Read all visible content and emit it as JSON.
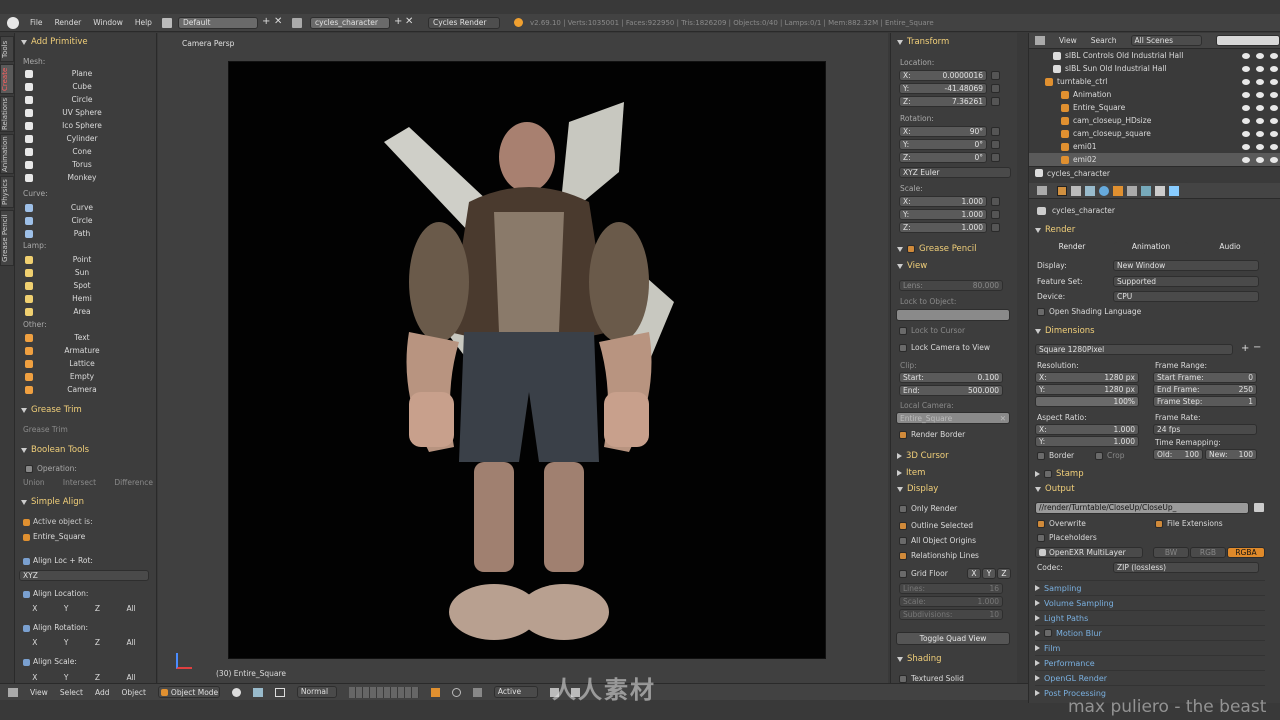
{
  "menubar": {
    "items": [
      "File",
      "Render",
      "Window",
      "Help"
    ],
    "layout": "Default",
    "scene": "cycles_character",
    "engine": "Cycles Render",
    "stats": "v2.69.10 | Verts:1035001 | Faces:922950 | Tris:1826209 | Objects:0/40 | Lamps:0/1 | Mem:882.32M | Entire_Square"
  },
  "tooltabs": [
    "Tools",
    "Create",
    "Relations",
    "Animation",
    "Physics",
    "Grease Pencil"
  ],
  "add_primitive": {
    "title": "Add Primitive",
    "mesh_label": "Mesh:",
    "mesh": [
      "Plane",
      "Cube",
      "Circle",
      "UV Sphere",
      "Ico Sphere",
      "Cylinder",
      "Cone",
      "Torus",
      "Monkey"
    ],
    "curve_label": "Curve:",
    "curve": [
      "Curve",
      "Circle",
      "Path"
    ],
    "lamp_label": "Lamp:",
    "lamp": [
      "Point",
      "Sun",
      "Spot",
      "Hemi",
      "Area"
    ],
    "other_label": "Other:",
    "other": [
      "Text",
      "Armature",
      "Lattice",
      "Empty",
      "Camera"
    ]
  },
  "grease_trim": {
    "title": "Grease Trim",
    "button": "Grease Trim"
  },
  "boolean_tools": {
    "title": "Boolean Tools",
    "operation": "Operation:",
    "ops": [
      "Union",
      "Intersect",
      "Difference"
    ]
  },
  "simple_align": {
    "title": "Simple Align",
    "active_label": "Active object is:",
    "active": "Entire_Square",
    "loc_rot": "Align Loc + Rot:",
    "xyz": "XYZ",
    "location": "Align Location:",
    "rotation": "Align Rotation:",
    "scale": "Align Scale:",
    "axes": [
      "X",
      "Y",
      "Z",
      "All"
    ]
  },
  "viewport": {
    "label": "Camera Persp",
    "object": "(30) Entire_Square"
  },
  "transform": {
    "title": "Transform",
    "location_label": "Location:",
    "loc": [
      {
        "a": "X:",
        "v": "0.0000016"
      },
      {
        "a": "Y:",
        "v": "-41.48069"
      },
      {
        "a": "Z:",
        "v": "7.36261"
      }
    ],
    "rotation_label": "Rotation:",
    "rot": [
      {
        "a": "X:",
        "v": "90°"
      },
      {
        "a": "Y:",
        "v": "0°"
      },
      {
        "a": "Z:",
        "v": "0°"
      }
    ],
    "euler": "XYZ Euler",
    "scale_label": "Scale:",
    "scl": [
      {
        "a": "X:",
        "v": "1.000"
      },
      {
        "a": "Y:",
        "v": "1.000"
      },
      {
        "a": "Z:",
        "v": "1.000"
      }
    ]
  },
  "npanel": {
    "grease_pencil": "Grease Pencil",
    "view": "View",
    "lens_label": "Lens:",
    "lens": "80.000",
    "lock_obj": "Lock to Object:",
    "lock_cursor": "Lock to Cursor",
    "lock_camera": "Lock Camera to View",
    "clip": "Clip:",
    "clip_start_l": "Start:",
    "clip_start": "0.100",
    "clip_end_l": "End:",
    "clip_end": "500.000",
    "local_camera": "Local Camera:",
    "local_camera_val": "Entire_Square",
    "render_border": "Render Border",
    "cursor3d": "3D Cursor",
    "item": "Item",
    "display": "Display",
    "only_render": "Only Render",
    "outline_sel": "Outline Selected",
    "all_origins": "All Object Origins",
    "rel_lines": "Relationship Lines",
    "grid_floor": "Grid Floor",
    "gaxes": [
      "X",
      "Y",
      "Z"
    ],
    "lines_l": "Lines:",
    "lines": "16",
    "scale_l": "Scale:",
    "scale": "1.000",
    "subdiv_l": "Subdivisions:",
    "subdiv": "10",
    "toggle_quad": "Toggle Quad View",
    "shading": "Shading",
    "textured_solid": "Textured Solid"
  },
  "outliner": {
    "menu": [
      "View",
      "Search",
      "All Scenes"
    ],
    "rows": [
      "sIBL Controls Old Industrial Hall",
      "sIBL Sun Old Industrial Hall",
      "turntable_ctrl",
      "Animation",
      "Entire_Square",
      "cam_closeup_HDsize",
      "cam_closeup_square",
      "emi01",
      "emi02",
      "cycles_character"
    ]
  },
  "props": {
    "scene": "cycles_character",
    "render_title": "Render",
    "render_btns": [
      "Render",
      "Animation",
      "Audio"
    ],
    "display_l": "Display:",
    "display": "New Window",
    "featureset_l": "Feature Set:",
    "featureset": "Supported",
    "device_l": "Device:",
    "device": "CPU",
    "osl": "Open Shading Language",
    "dimensions": "Dimensions",
    "preset": "Square 1280Pixel",
    "resolution": "Resolution:",
    "resx_l": "X:",
    "resx": "1280 px",
    "resy_l": "Y:",
    "resy": "1280 px",
    "respct": "100%",
    "frame_range": "Frame Range:",
    "start_l": "Start Frame:",
    "start": "0",
    "end_l": "End Frame:",
    "end": "250",
    "step_l": "Frame Step:",
    "step": "1",
    "aspect": "Aspect Ratio:",
    "ax_l": "X:",
    "ax": "1.000",
    "ay_l": "Y:",
    "ay": "1.000",
    "frame_rate": "Frame Rate:",
    "fps": "24 fps",
    "remap": "Time Remapping:",
    "old_l": "Old:",
    "old": "100",
    "new_l": "New:",
    "new": "100",
    "border": "Border",
    "crop": "Crop",
    "stamp": "Stamp",
    "output": "Output",
    "path": "//render/Turntable/CloseUp/CloseUp_",
    "overwrite": "Overwrite",
    "file_ext": "File Extensions",
    "placeholders": "Placeholders",
    "format": "OpenEXR MultiLayer",
    "bw": "BW",
    "rgb": "RGB",
    "rgba": "RGBA",
    "codec_l": "Codec:",
    "codec": "ZIP (lossless)",
    "sections": [
      "Sampling",
      "Volume Sampling",
      "Light Paths",
      "Motion Blur",
      "Film",
      "Performance",
      "OpenGL Render",
      "Post Processing"
    ]
  },
  "bottombar": {
    "items": [
      "View",
      "Select",
      "Add",
      "Object"
    ],
    "mode": "Object Mode",
    "shading": "Normal",
    "orient": "Active"
  },
  "watermark": "人人素材",
  "credit": "max puliero - the beast"
}
